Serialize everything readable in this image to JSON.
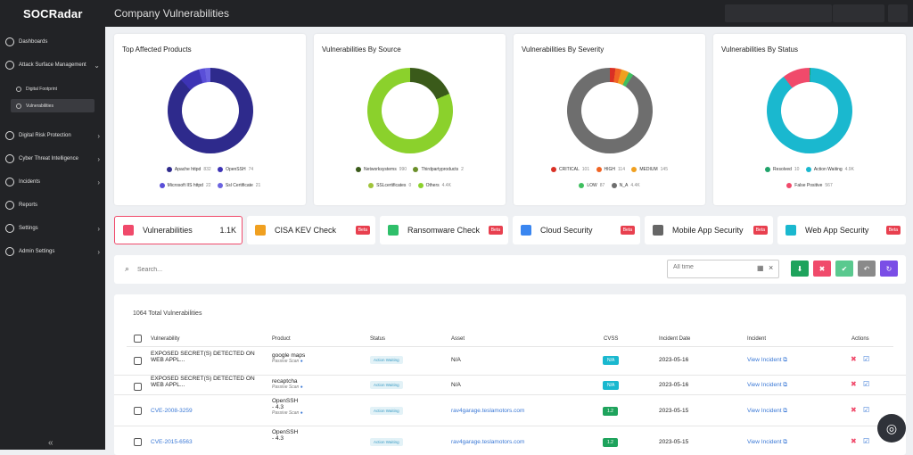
{
  "brand": {
    "logo": "SOCRadar"
  },
  "header": {
    "title": "Company Vulnerabilities"
  },
  "sidebar": {
    "items": [
      {
        "label": "Dashboards"
      },
      {
        "label": "Attack Surface Management"
      },
      {
        "label": "Digital Footprint"
      },
      {
        "label": "Vulnerabilities"
      },
      {
        "label": "Digital Risk Protection"
      },
      {
        "label": "Cyber Threat Intelligence"
      },
      {
        "label": "Incidents"
      },
      {
        "label": "Reports"
      },
      {
        "label": "Settings"
      },
      {
        "label": "Admin Settings"
      }
    ],
    "collapse_icon": "double-chevron-left"
  },
  "charts": [
    {
      "title": "Top Affected Products",
      "legend": [
        {
          "label": "Apache httpd",
          "count": "832",
          "color": "#2e2a8c"
        },
        {
          "label": "OpenSSH",
          "count": "74",
          "color": "#3d33b5"
        },
        {
          "label": "Microsoft IIS httpd",
          "count": "22",
          "color": "#5a4fd8"
        },
        {
          "label": "Ssl Certificate",
          "count": "21",
          "color": "#6b63e0"
        }
      ]
    },
    {
      "title": "Vulnerabilities By Source",
      "legend": [
        {
          "label": "Networksystems",
          "count": "990",
          "color": "#3a5a1a"
        },
        {
          "label": "Thirdpartyproducts",
          "count": "2",
          "color": "#6b8f2a"
        },
        {
          "label": "SSLcertificates",
          "count": "0",
          "color": "#a0c43a"
        },
        {
          "label": "Others",
          "count": "4.4K",
          "color": "#8bd12c"
        }
      ]
    },
    {
      "title": "Vulnerabilities By Severity",
      "legend": [
        {
          "label": "CRITICAL",
          "count": "101",
          "color": "#d93025"
        },
        {
          "label": "HIGH",
          "count": "114",
          "color": "#f06424"
        },
        {
          "label": "MEDIUM",
          "count": "145",
          "color": "#f0a020"
        },
        {
          "label": "LOW",
          "count": "87",
          "color": "#3fbf5f"
        },
        {
          "label": "N_A",
          "count": "4.4K",
          "color": "#6e6e6e"
        }
      ]
    },
    {
      "title": "Vulnerabilities By Status",
      "legend": [
        {
          "label": "Resolved",
          "count": "10",
          "color": "#1fa36a"
        },
        {
          "label": "Action Waiting",
          "count": "4.9K",
          "color": "#1ab8cf"
        },
        {
          "label": "False Positive",
          "count": "567",
          "color": "#f04a6b"
        }
      ]
    }
  ],
  "tabs": [
    {
      "label": "Vulnerabilities",
      "count": "1.1K",
      "color": "#f04a6b"
    },
    {
      "label": "CISA KEV Check",
      "badge": "Beta",
      "color": "#f0a020"
    },
    {
      "label": "Ransomware Check",
      "badge": "Beta",
      "color": "#2fbf6a"
    },
    {
      "label": "Cloud Security",
      "badge": "Beta",
      "color": "#3a86f0"
    },
    {
      "label": "Mobile App Security",
      "badge": "Beta",
      "color": "#666"
    },
    {
      "label": "Web App Security",
      "badge": "Beta",
      "color": "#1ab8cf"
    }
  ],
  "search": {
    "placeholder": "Search...",
    "date_placeholder": "All time"
  },
  "table": {
    "total": "1064 Total Vulnerabilities",
    "headers": [
      "Vulnerability",
      "Product",
      "Status",
      "Asset",
      "CVSS",
      "Incident Date",
      "Incident",
      "Actions"
    ],
    "rows": [
      {
        "vuln1": "EXPOSED SECRET(S) DETECTED ON",
        "vuln2": "WEB APPL...",
        "product": "google maps",
        "sub": "Passive Scan",
        "status": "Action Waiting",
        "asset": "N/A",
        "cvss": "N/A",
        "date": "2023-05-16",
        "incident": "View Incident"
      },
      {
        "vuln1": "EXPOSED SECRET(S) DETECTED ON",
        "vuln2": "WEB APPL...",
        "product": "recaptcha",
        "sub": "Passive Scan",
        "status": "Action Waiting",
        "asset": "N/A",
        "cvss": "N/A",
        "date": "2023-05-16",
        "incident": "View Incident"
      },
      {
        "vuln1": "CVE-2008-3259",
        "product1": "OpenSSH",
        "product2": "- 4.3",
        "sub": "Passive Scan",
        "status": "Action Waiting",
        "asset": "rav4garage.teslamotors.com",
        "cvss": "1.2",
        "date": "2023-05-15",
        "incident": "View Incident"
      },
      {
        "vuln1": "CVE-2015-6563",
        "product1": "OpenSSH",
        "product2": "- 4.3",
        "status": "Action Waiting",
        "asset": "rav4garage.teslamotors.com",
        "cvss": "1.2",
        "date": "2023-05-15",
        "incident": "View Incident"
      }
    ]
  },
  "icons": {
    "search": "search-icon",
    "calendar": "calendar-icon",
    "help": "lifebuoy-icon"
  }
}
